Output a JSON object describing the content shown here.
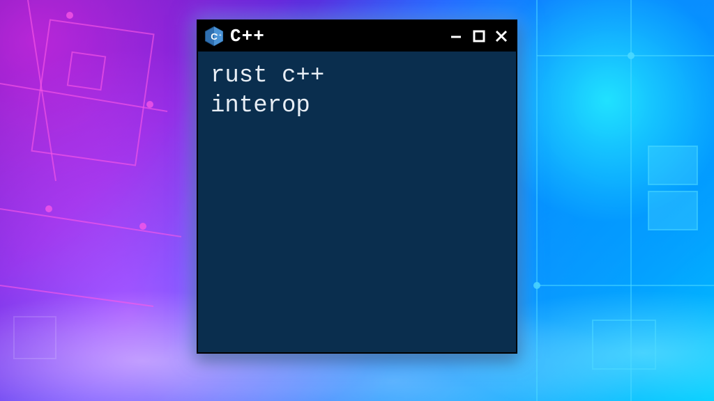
{
  "window": {
    "title": "C++",
    "icon": "cpp-hex-icon"
  },
  "terminal": {
    "content": "rust c++\ninterop"
  },
  "colors": {
    "terminal_bg": "#0a2e4e",
    "titlebar_bg": "#000000",
    "text": "#e8eef5"
  }
}
